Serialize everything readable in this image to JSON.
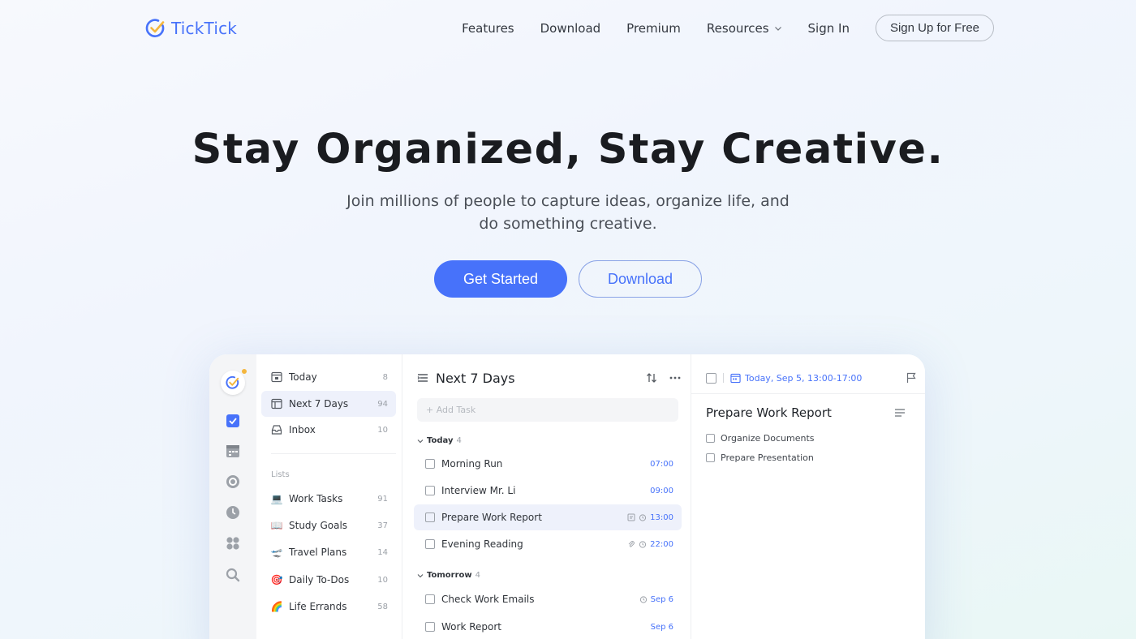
{
  "brand": {
    "name": "TickTick",
    "color": "#4772fa"
  },
  "nav": {
    "links": [
      "Features",
      "Download",
      "Premium",
      "Resources",
      "Sign In"
    ],
    "signup": "Sign Up for Free"
  },
  "hero": {
    "title": "Stay Organized, Stay Creative.",
    "subtitle": "Join millions of people to capture ideas, organize life, and do something creative.",
    "primary_cta": "Get Started",
    "secondary_cta": "Download"
  },
  "app": {
    "sidebar": {
      "smart_lists": [
        {
          "icon": "calendar-day-icon",
          "label": "Today",
          "count": "8"
        },
        {
          "icon": "calendar-week-icon",
          "label": "Next 7 Days",
          "count": "94",
          "active": true
        },
        {
          "icon": "inbox-icon",
          "label": "Inbox",
          "count": "10"
        }
      ],
      "lists_heading": "Lists",
      "lists": [
        {
          "emoji": "💻",
          "label": "Work Tasks",
          "count": "91"
        },
        {
          "emoji": "📖",
          "label": "Study Goals",
          "count": "37"
        },
        {
          "emoji": "🛫",
          "label": "Travel Plans",
          "count": "14"
        },
        {
          "emoji": "🎯",
          "label": "Daily To-Dos",
          "count": "10"
        },
        {
          "emoji": "🌈",
          "label": "Life Errands",
          "count": "58"
        }
      ]
    },
    "list": {
      "title": "Next 7 Days",
      "add_placeholder": "+ Add Task",
      "groups": [
        {
          "label": "Today",
          "count": "4",
          "tasks": [
            {
              "label": "Morning Run",
              "meta": "07:00"
            },
            {
              "label": "Interview Mr. Li",
              "meta": "09:00"
            },
            {
              "label": "Prepare Work Report",
              "meta": "13:00",
              "active": true
            },
            {
              "label": "Evening Reading",
              "meta": "22:00"
            }
          ]
        },
        {
          "label": "Tomorrow",
          "count": "4",
          "tasks": [
            {
              "label": "Check Work Emails",
              "meta": "Sep 6"
            },
            {
              "label": "Work Report",
              "meta": "Sep 6"
            }
          ]
        }
      ]
    },
    "detail": {
      "date": "Today, Sep 5, 13:00-17:00",
      "title": "Prepare Work Report",
      "subtasks": [
        "Organize Documents",
        "Prepare Presentation"
      ]
    }
  }
}
